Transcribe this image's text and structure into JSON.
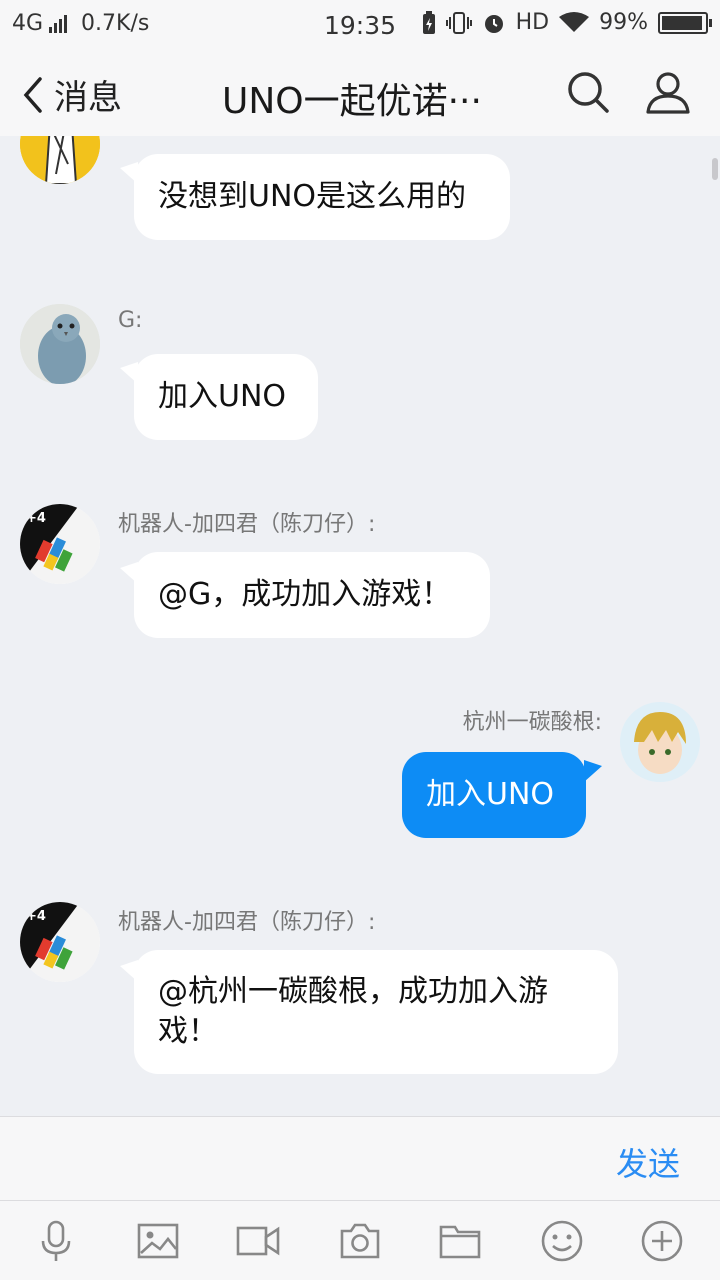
{
  "status_bar": {
    "network": "4G",
    "speed": "0.7K/s",
    "time": "19:35",
    "hd": "HD",
    "battery": "99%"
  },
  "header": {
    "back_label": "消息",
    "title": "UNO一起优诺···"
  },
  "messages": [
    {
      "sender": "",
      "text": "没想到UNO是这么用的",
      "side": "left",
      "avatar": "sketch-avatar"
    },
    {
      "sender": "G:",
      "text": "加入UNO",
      "side": "left",
      "avatar": "bird-avatar"
    },
    {
      "sender": "机器人-加四君（陈刀仔）:",
      "text": "@G，成功加入游戏！",
      "side": "left",
      "avatar": "uno-card-avatar"
    },
    {
      "sender": "杭州一碳酸根:",
      "text": "加入UNO",
      "side": "right",
      "avatar": "anime-avatar"
    },
    {
      "sender": "机器人-加四君（陈刀仔）:",
      "text_line1": "@杭州一碳酸根，成功加入游",
      "text_line2": "戏！",
      "side": "left",
      "avatar": "uno-card-avatar"
    }
  ],
  "input": {
    "send_label": "发送"
  },
  "toolbar": [
    "microphone-icon",
    "image-icon",
    "video-icon",
    "camera-icon",
    "folder-icon",
    "emoji-icon",
    "plus-icon"
  ],
  "colors": {
    "accent": "#0d8cf5",
    "send": "#2a8cf3",
    "background": "#eef0f4"
  }
}
